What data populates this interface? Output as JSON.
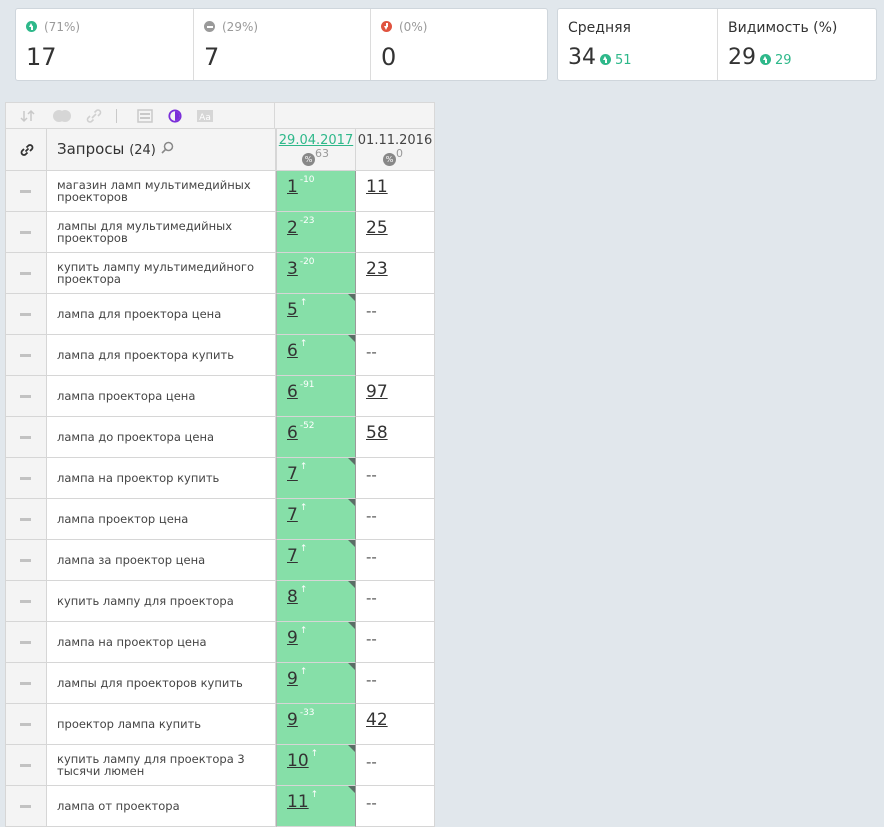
{
  "summary": {
    "up": {
      "pct": "(71%)",
      "count": "17"
    },
    "neutral": {
      "pct": "(29%)",
      "count": "7"
    },
    "down": {
      "pct": "(0%)",
      "count": "0"
    }
  },
  "metrics": {
    "average": {
      "label": "Средняя",
      "value": "34",
      "delta": "51"
    },
    "visibility": {
      "label": "Видимость (%)",
      "value": "29",
      "delta": "29"
    }
  },
  "colors": {
    "accent": "#2eb88a",
    "up": "#2eb88a",
    "down": "#e0533f",
    "neutral": "#9a9a9a",
    "active_column": "#86dfa8"
  },
  "table": {
    "title": "Запросы",
    "count": "(24)",
    "dates": [
      {
        "label": "29.04.2017",
        "badge_count": "63"
      },
      {
        "label": "01.11.2016",
        "badge_count": "0"
      }
    ],
    "rows": [
      {
        "keyword": "магазин ламп мультимедийных проекторов",
        "pos": "1",
        "change": "-10",
        "prev": "11"
      },
      {
        "keyword": "лампы для мультимедийных проекторов",
        "pos": "2",
        "change": "-23",
        "prev": "25"
      },
      {
        "keyword": "купить лампу мультимедийного проектора",
        "pos": "3",
        "change": "-20",
        "prev": "23"
      },
      {
        "keyword": "лампа для проектора цена",
        "pos": "5",
        "change": "↑",
        "prev": "--"
      },
      {
        "keyword": "лампа для проектора купить",
        "pos": "6",
        "change": "↑",
        "prev": "--"
      },
      {
        "keyword": "лампа проектора цена",
        "pos": "6",
        "change": "-91",
        "prev": "97"
      },
      {
        "keyword": "лампа до проектора цена",
        "pos": "6",
        "change": "-52",
        "prev": "58"
      },
      {
        "keyword": "лампа на проектор купить",
        "pos": "7",
        "change": "↑",
        "prev": "--"
      },
      {
        "keyword": "лампа проектор цена",
        "pos": "7",
        "change": "↑",
        "prev": "--"
      },
      {
        "keyword": "лампа за проектор цена",
        "pos": "7",
        "change": "↑",
        "prev": "--"
      },
      {
        "keyword": "купить лампу для проектора",
        "pos": "8",
        "change": "↑",
        "prev": "--"
      },
      {
        "keyword": "лампа на проектор цена",
        "pos": "9",
        "change": "↑",
        "prev": "--"
      },
      {
        "keyword": "лампы для проекторов купить",
        "pos": "9",
        "change": "↑",
        "prev": "--"
      },
      {
        "keyword": "проектор лампа купить",
        "pos": "9",
        "change": "-33",
        "prev": "42"
      },
      {
        "keyword": "купить лампу для проектора 3 тысячи люмен",
        "pos": "10",
        "change": "↑",
        "prev": "--"
      },
      {
        "keyword": "лампа от проектора",
        "pos": "11",
        "change": "↑",
        "prev": "--"
      }
    ]
  }
}
